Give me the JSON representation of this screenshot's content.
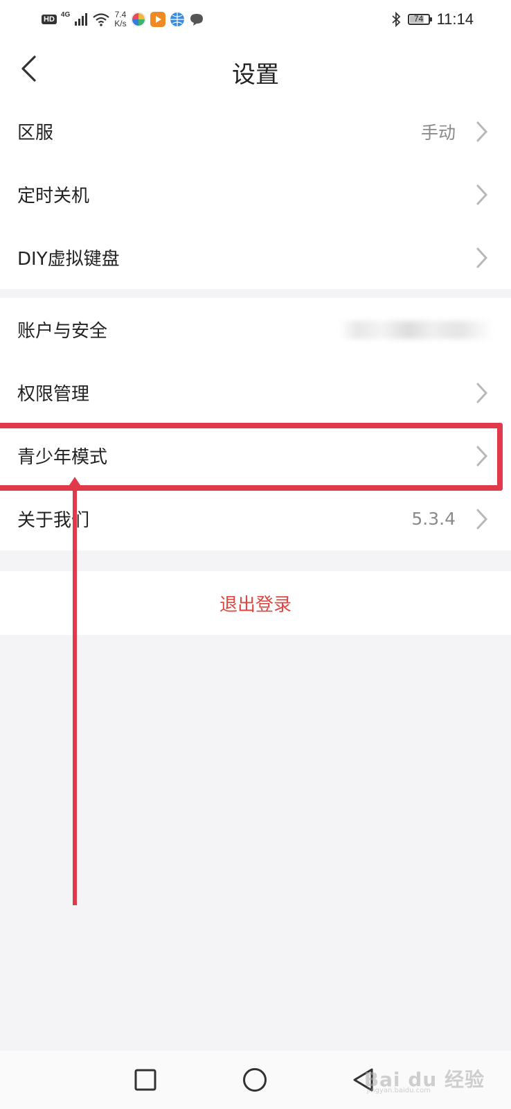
{
  "status_bar": {
    "hd": "HD",
    "network": "4G",
    "speed_value": "7.4",
    "speed_unit": "K/s",
    "battery_level": "74",
    "time": "11:14",
    "icons": [
      "signal-icon",
      "wifi-icon",
      "app-pinwheel-icon",
      "app-video-icon",
      "app-globe-icon",
      "message-icon",
      "bluetooth-icon",
      "battery-icon"
    ]
  },
  "header": {
    "title": "设置",
    "back_icon": "chevron-left-icon"
  },
  "settings_group_1": [
    {
      "label": "区服",
      "value": "手动"
    },
    {
      "label": "定时关机",
      "value": ""
    },
    {
      "label": "DIY虚拟键盘",
      "value": ""
    }
  ],
  "settings_group_2": [
    {
      "label": "账户与安全",
      "value": ""
    },
    {
      "label": "权限管理",
      "value": ""
    },
    {
      "label": "青少年模式",
      "value": ""
    },
    {
      "label": "关于我们",
      "value": "5.3.4"
    }
  ],
  "logout": {
    "label": "退出登录"
  },
  "annotation": {
    "color": "#e03a4a"
  },
  "nav_bar": {
    "icons": [
      "recent-apps-icon",
      "home-icon",
      "back-icon"
    ]
  },
  "watermark": {
    "main": "Bai du 经验",
    "sub": "jingyan.baidu.com"
  },
  "colors": {
    "accent_red": "#e0453f",
    "background": "#f4f4f6",
    "value_text": "#8a8a8a"
  }
}
